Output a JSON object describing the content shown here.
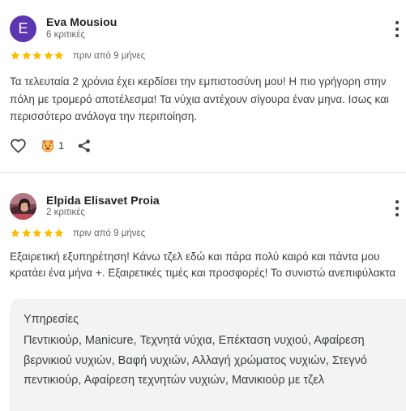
{
  "reviews": [
    {
      "avatar_letter": "E",
      "avatar_color": "#5e35b1",
      "name": "Eva Mousiou",
      "review_count": "6 κριτικές",
      "rating": 5,
      "time": "πριν από 9 μήνες",
      "text": "Τα τελευταία 2 χρόνια έχει κερδίσει την εμπιστοσύνη μου! Η πιο γρήγορη στην πόλη με τρομερό αποτέλεσμα! Τα νύχια αντέχουν σίγουρα έναν μηνα. Ισως και περισσότερο ανάλογα την περιποίηση.",
      "reaction_count": "1"
    },
    {
      "avatar": "profile-photo",
      "name": "Elpida Elisavet Proia",
      "review_count": "2 κριτικές",
      "rating": 5,
      "time": "πριν από 9 μήνες",
      "text": "Εξαιρετική εξυπηρέτηση! Κάνω τζελ εδώ και πάρα πολύ καιρό και πάντα μου κρατάει ένα μήνα +. Εξαιρετικές τιμές και προσφορές! Το συνιστώ ανεπιφύλακτα",
      "services_title": "Υπηρεσίες",
      "services": "Πεντικιούρ, Manicure, Τεχνητά νύχια, Επέκταση νυχιού, Αφαίρεση βερνικιού νυχιών, Βαφή νυχιών, Αλλαγή χρώματος νυχιών, Στεγνό πεντικιούρ, Αφαίρεση τεχνητών νυχιών, Μανικιούρ με τζελ"
    }
  ],
  "colors": {
    "star": "#fbbc04",
    "text": "#3c4043",
    "muted": "#5f6368",
    "services_bg": "#f1f3f4"
  },
  "icons": [
    "more-vert-icon",
    "star-icon",
    "like-heart-icon",
    "reaction-emoji-icon",
    "share-icon"
  ]
}
